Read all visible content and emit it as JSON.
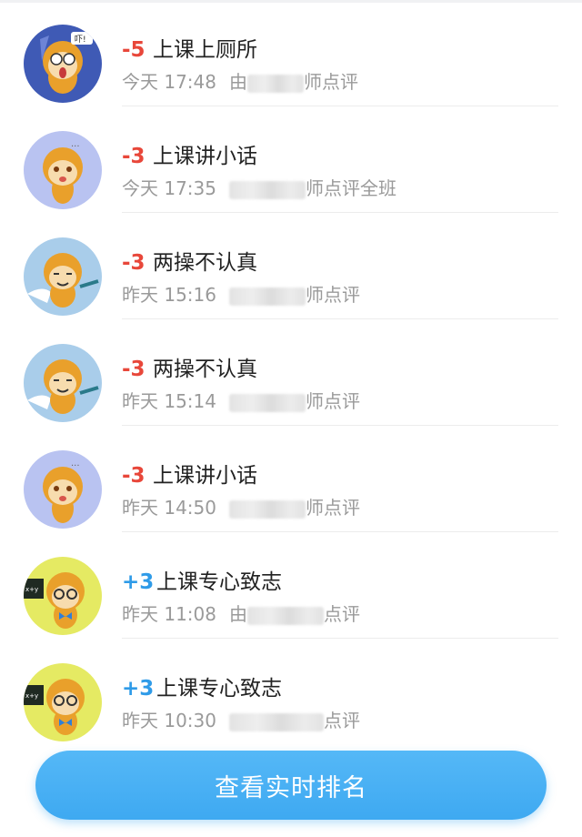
{
  "records": [
    {
      "score": "-5",
      "sign": "neg",
      "reason": "上课上厕所",
      "time": "今天 17:48",
      "by": "由",
      "comment": "师点评",
      "avatar": "monkey-shocked-icon",
      "avatar_bg": "#3f5ab5"
    },
    {
      "score": "-3",
      "sign": "neg",
      "reason": "上课讲小话",
      "time": "今天 17:35",
      "by": "",
      "comment": "师点评全班",
      "avatar": "monkey-chatting-icon",
      "avatar_bg": "#b9c3f1"
    },
    {
      "score": "-3",
      "sign": "neg",
      "reason": "两操不认真",
      "time": "昨天 15:16",
      "by": "",
      "comment": "师点评",
      "avatar": "monkey-lazy-icon",
      "avatar_bg": "#a9cdea"
    },
    {
      "score": "-3",
      "sign": "neg",
      "reason": "两操不认真",
      "time": "昨天 15:14",
      "by": "",
      "comment": "师点评",
      "avatar": "monkey-lazy-icon",
      "avatar_bg": "#a9cdea"
    },
    {
      "score": "-3",
      "sign": "neg",
      "reason": "上课讲小话",
      "time": "昨天 14:50",
      "by": "",
      "comment": "师点评",
      "avatar": "monkey-chatting-icon",
      "avatar_bg": "#b9c3f1"
    },
    {
      "score": "+3",
      "sign": "pos",
      "reason": "上课专心致志",
      "time": "昨天 11:08",
      "by": "由",
      "comment": "点评",
      "avatar": "monkey-studying-icon",
      "avatar_bg": "#e5ea63"
    },
    {
      "score": "+3",
      "sign": "pos",
      "reason": "上课专心致志",
      "time": "昨天 10:30",
      "by": "",
      "comment": "点评",
      "avatar": "monkey-studying-icon",
      "avatar_bg": "#e5ea63"
    }
  ],
  "cta_label": "查看实时排名",
  "colors": {
    "negative": "#e8473a",
    "positive": "#2f9be8",
    "button": "#3ea9f1"
  }
}
